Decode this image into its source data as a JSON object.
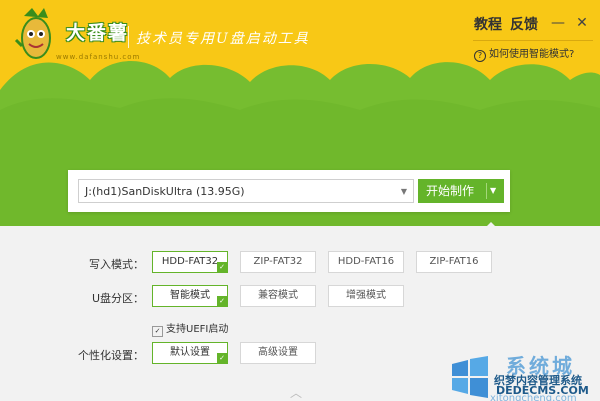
{
  "header": {
    "brand": "大番薯",
    "site": "www.dafanshu.com",
    "slogan": "技术员专用U盘启动工具",
    "nav_tutorial": "教程",
    "nav_feedback": "反馈",
    "help_text": "如何使用智能模式?",
    "window_minimize": "—",
    "window_close": "✕"
  },
  "drive": {
    "selected": "J:(hd1)SanDiskUltra (13.95G)",
    "start_label": "开始制作"
  },
  "write_mode": {
    "label": "写入模式：",
    "options": [
      "HDD-FAT32",
      "ZIP-FAT32",
      "HDD-FAT16",
      "ZIP-FAT16"
    ],
    "selected": "HDD-FAT32"
  },
  "partition": {
    "label": "U盘分区：",
    "options": [
      "智能模式",
      "兼容模式",
      "增强模式"
    ],
    "selected": "智能模式"
  },
  "uefi": {
    "label": "支持UEFI启动",
    "checked": true
  },
  "personalize": {
    "label": "个性化设置：",
    "options": [
      "默认设置",
      "高级设置"
    ],
    "selected": "默认设置"
  },
  "watermark": {
    "line1": "系统城",
    "line2": "织梦内容管理系统",
    "line3": "DEDECMS.COM",
    "line4": "xitongcheng.com"
  },
  "colors": {
    "header_yellow": "#f8c816",
    "hill_green": "#76bd30",
    "accent_green": "#64b42a"
  }
}
